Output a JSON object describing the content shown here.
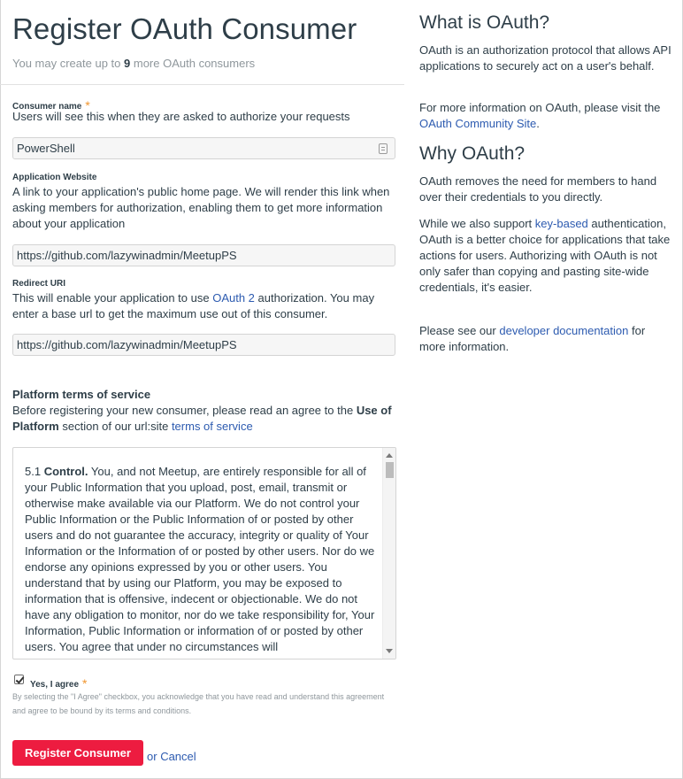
{
  "left": {
    "title": "Register OAuth Consumer",
    "subtitle_prefix": "You may create up to",
    "subtitle_count": "9",
    "subtitle_suffix": "more OAuth consumers",
    "consumer_name": {
      "label": "Consumer name",
      "required_mark": "*",
      "help": "Users will see this when they are asked to authorize your requests",
      "value": "PowerShell"
    },
    "app_website": {
      "label": "Application Website",
      "help": "A link to your application's public home page. We will render this link when asking members for authorization, enabling them to get more information about your application",
      "value": "https://github.com/lazywinadmin/MeetupPS"
    },
    "redirect_uri": {
      "label": "Redirect URI",
      "help_before": "This will enable your application to use",
      "help_link": "OAuth 2",
      "help_after": "authorization. You may enter a base url to get the maximum use out of this consumer.",
      "value": "https://github.com/lazywinadmin/MeetupPS"
    },
    "platform_terms": {
      "heading": "Platform terms of service",
      "text_before": "Before registering your new consumer, please read an agree to the",
      "text_bold": "Use of Platform",
      "text_middle": "section of our url:site",
      "text_link": "terms of service",
      "terms_number": "5.1",
      "terms_bold": "Control.",
      "terms_body": "You, and not Meetup, are entirely responsible for all of your Public Information that you upload, post, email, transmit or otherwise make available via our Platform. We do not control your Public Information or the Public Information of or posted by other users and do not guarantee the accuracy, integrity or quality of Your Information or the Information of or posted by other users. Nor do we endorse any opinions expressed by you or other users. You understand that by using our Platform, you may be exposed to information that is offensive, indecent or objectionable. We do not have any obligation to monitor, nor do we take responsibility for, Your Information, Public Information or information of or posted by other users. You agree that under no circumstances will"
    },
    "agree": {
      "checked": true,
      "label": "Yes, I agree",
      "required_mark": "*",
      "note": "By selecting the \"I Agree\" checkbox, you acknowledge that you have read and understand this agreement and agree to be bound by its terms and conditions."
    },
    "actions": {
      "submit_label": "Register Consumer",
      "or_text": "or",
      "cancel_label": "Cancel"
    }
  },
  "right": {
    "what_heading": "What is OAuth?",
    "what_p1": "OAuth is an authorization protocol that allows API applications to securely act on a user's behalf.",
    "what_p2_before": "For more information on OAuth, please visit the",
    "what_p2_link": "OAuth Community Site",
    "what_p2_after": ".",
    "why_heading": "Why OAuth?",
    "why_p1": "OAuth removes the need for members to hand over their credentials to you directly.",
    "why_p2_before": "While we also support",
    "why_p2_link": "key-based",
    "why_p2_after": "authentication, OAuth is a better choice for applications that take actions for users. Authorizing with OAuth is not only safer than copying and pasting site-wide credentials, it's easier.",
    "why_p3_before": "Please see our",
    "why_p3_link": "developer documentation",
    "why_p3_after": "for more information."
  },
  "colors": {
    "primary_button": "#ed1c40",
    "link": "#2d5bb0",
    "required": "#f0952e",
    "text": "#2e3e48",
    "muted": "#8f979c"
  },
  "icons": [
    "form-field-icon",
    "checkbox-checked-icon",
    "scroll-up-icon",
    "scroll-down-icon"
  ]
}
